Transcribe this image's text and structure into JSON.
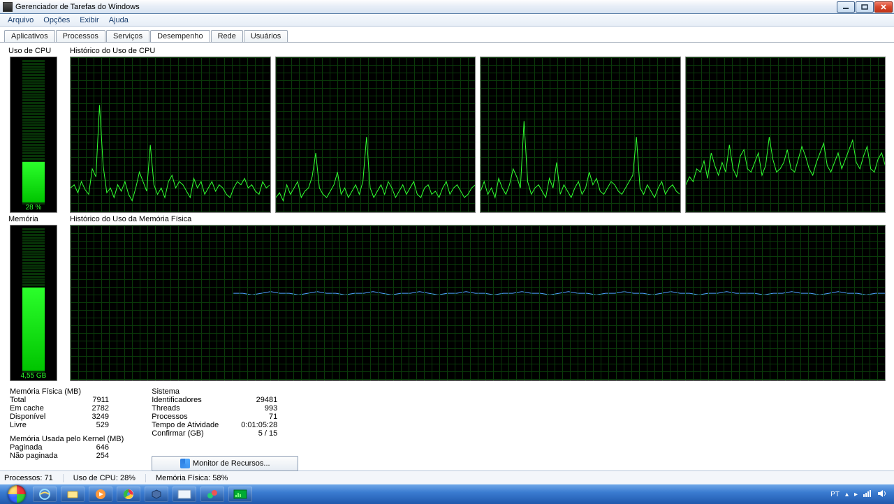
{
  "window": {
    "title": "Gerenciador de Tarefas do Windows"
  },
  "menu": {
    "items": [
      "Arquivo",
      "Opções",
      "Exibir",
      "Ajuda"
    ]
  },
  "tabs": {
    "items": [
      "Aplicativos",
      "Processos",
      "Serviços",
      "Desempenho",
      "Rede",
      "Usuários"
    ],
    "active_index": 3
  },
  "labels": {
    "cpu_usage": "Uso de CPU",
    "cpu_history": "Histórico do Uso de CPU",
    "memory": "Memória",
    "mem_history": "Histórico do Uso da Memória Física",
    "phys_mem_hdr": "Memória Física (MB)",
    "kernel_mem_hdr": "Memória Usada pelo Kernel (MB)",
    "system_hdr": "Sistema",
    "resource_monitor": "Monitor de Recursos..."
  },
  "meters": {
    "cpu": {
      "value_label": "28 %",
      "fill_pct": 28
    },
    "mem": {
      "value_label": "4,55 GB",
      "fill_pct": 58
    }
  },
  "phys_mem": {
    "total_label": "Total",
    "total": "7911",
    "cache_label": "Em cache",
    "cache": "2782",
    "avail_label": "Disponível",
    "avail": "3249",
    "free_label": "Livre",
    "free": "529"
  },
  "kernel_mem": {
    "paged_label": "Paginada",
    "paged": "646",
    "nonpaged_label": "Não paginada",
    "nonpaged": "254"
  },
  "system": {
    "handles_label": "Identificadores",
    "handles": "29481",
    "threads_label": "Threads",
    "threads": "993",
    "procs_label": "Processos",
    "procs": "71",
    "uptime_label": "Tempo de Atividade",
    "uptime": "0:01:05:28",
    "commit_label": "Confirmar (GB)",
    "commit": "5 / 15"
  },
  "statusbar": {
    "processes": "Processos: 71",
    "cpu": "Uso de CPU: 28%",
    "mem": "Memória Física: 58%"
  },
  "tray": {
    "lang": "PT"
  },
  "chart_data": {
    "cpu_cores": [
      {
        "type": "line",
        "ylim": [
          0,
          100
        ],
        "values": [
          18,
          20,
          15,
          22,
          17,
          14,
          30,
          25,
          70,
          32,
          15,
          18,
          12,
          20,
          16,
          22,
          14,
          10,
          18,
          28,
          22,
          16,
          45,
          20,
          14,
          18,
          12,
          22,
          26,
          18,
          22,
          20,
          16,
          12,
          24,
          18,
          22,
          14,
          18,
          22,
          16,
          20,
          18,
          14,
          12,
          18,
          22,
          20,
          24,
          18,
          20,
          16,
          14,
          22,
          18,
          20
        ]
      },
      {
        "type": "line",
        "ylim": [
          0,
          100
        ],
        "values": [
          12,
          15,
          10,
          20,
          14,
          18,
          22,
          12,
          16,
          18,
          25,
          40,
          18,
          14,
          12,
          16,
          20,
          28,
          14,
          18,
          12,
          16,
          20,
          14,
          22,
          50,
          18,
          12,
          16,
          20,
          14,
          22,
          18,
          12,
          16,
          20,
          14,
          18,
          22,
          14,
          12,
          18,
          20,
          14,
          16,
          12,
          18,
          22,
          14,
          18,
          20,
          16,
          12,
          14,
          18,
          20
        ]
      },
      {
        "type": "line",
        "ylim": [
          0,
          100
        ],
        "values": [
          16,
          22,
          14,
          18,
          12,
          24,
          18,
          14,
          20,
          30,
          25,
          18,
          60,
          22,
          14,
          18,
          20,
          16,
          12,
          24,
          18,
          34,
          14,
          20,
          16,
          12,
          18,
          22,
          14,
          18,
          28,
          20,
          24,
          16,
          14,
          18,
          22,
          20,
          16,
          14,
          18,
          22,
          26,
          50,
          18,
          14,
          20,
          16,
          12,
          18,
          22,
          14,
          18,
          20,
          16,
          14
        ]
      },
      {
        "type": "line",
        "ylim": [
          0,
          100
        ],
        "values": [
          20,
          25,
          22,
          30,
          28,
          35,
          24,
          40,
          32,
          26,
          34,
          28,
          45,
          30,
          25,
          38,
          42,
          30,
          28,
          34,
          40,
          26,
          32,
          50,
          36,
          28,
          30,
          34,
          42,
          30,
          28,
          36,
          44,
          38,
          30,
          26,
          34,
          40,
          46,
          32,
          28,
          34,
          40,
          30,
          36,
          42,
          48,
          34,
          30,
          38,
          44,
          30,
          28,
          36,
          40,
          32
        ]
      }
    ],
    "memory": {
      "type": "line",
      "ylim": [
        0,
        100
      ],
      "start_index_pct": 20,
      "values": [
        58,
        58,
        57,
        58,
        59,
        58,
        58,
        57,
        58,
        59,
        58,
        58,
        57,
        58,
        58,
        59,
        58,
        57,
        58,
        58,
        59,
        58,
        57,
        58,
        58,
        59,
        58,
        58,
        57,
        58,
        58,
        59,
        58,
        58,
        57,
        58,
        59,
        58,
        58,
        57,
        58,
        58,
        59,
        58,
        58,
        57,
        58,
        59,
        58,
        58,
        57,
        58,
        58,
        59,
        58,
        58,
        58,
        57,
        58,
        58,
        59,
        58,
        58,
        57,
        58,
        59,
        58,
        58,
        57,
        58,
        58
      ]
    }
  }
}
